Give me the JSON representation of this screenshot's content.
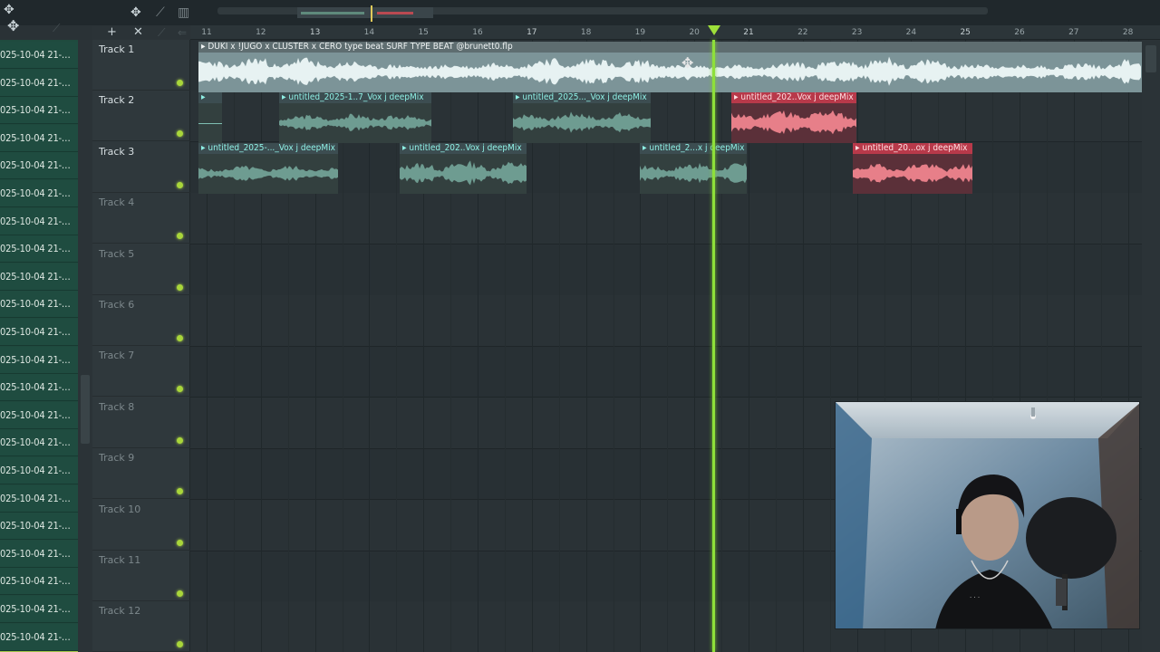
{
  "browser": {
    "items": [
      "025-10-04 21-…",
      "025-10-04 21-…",
      "025-10-04 21-…",
      "025-10-04 21-…",
      "025-10-04 21-…",
      "025-10-04 21-…",
      "025-10-04 21-…",
      "025-10-04 21-…",
      "025-10-04 21-…",
      "025-10-04 21-…",
      "025-10-04 21-…",
      "025-10-04 21-…",
      "025-10-04 21-…",
      "025-10-04 21-…",
      "025-10-04 21-…",
      "025-10-04 21-…",
      "025-10-04 21-…",
      "025-10-04 21-…",
      "025-10-04 21-…",
      "025-10-04 21-…",
      "025-10-04 21-…",
      "025-10-04 21-…",
      "025-10-04 21-…"
    ],
    "selected_index": 22
  },
  "tracks": [
    "Track 1",
    "Track 2",
    "Track 3",
    "Track 4",
    "Track 5",
    "Track 6",
    "Track 7",
    "Track 8",
    "Track 9",
    "Track 10",
    "Track 11",
    "Track 12"
  ],
  "ruler": {
    "bars": [
      "11",
      "12",
      "13",
      "14",
      "15",
      "16",
      "17",
      "18",
      "19",
      "20",
      "21",
      "22",
      "23",
      "24",
      "25",
      "26",
      "27",
      "28"
    ]
  },
  "clips": {
    "master": "DUKI x !JUGO x CLÜSTER x CERO type beat  SURF TYPE BEAT @brunett0.flp",
    "t2a": "",
    "t2b": "untitled_2025-1..7_Vox j deepMix",
    "t2c": "untitled_2025..._Vox j deepMix",
    "t2d": "untitled_202..Vox j deepMix",
    "t3a": "untitled_2025-..._Vox j deepMix",
    "t3b": "untitled_202..Vox j deepMix",
    "t3c": "untitled_2...x j deepMix",
    "t3d": "untitled_20...ox j deepMix"
  },
  "icons": {
    "toolbar": [
      "move-icon",
      "snap-icon",
      "piano-icon",
      "add-icon",
      "close-icon"
    ],
    "playhead": "playhead-marker-icon"
  },
  "colors": {
    "playhead": "#8ee03a",
    "clip_teal": "#8ff0e5",
    "clip_red": "#b8394a",
    "led": "#a9d63a"
  }
}
